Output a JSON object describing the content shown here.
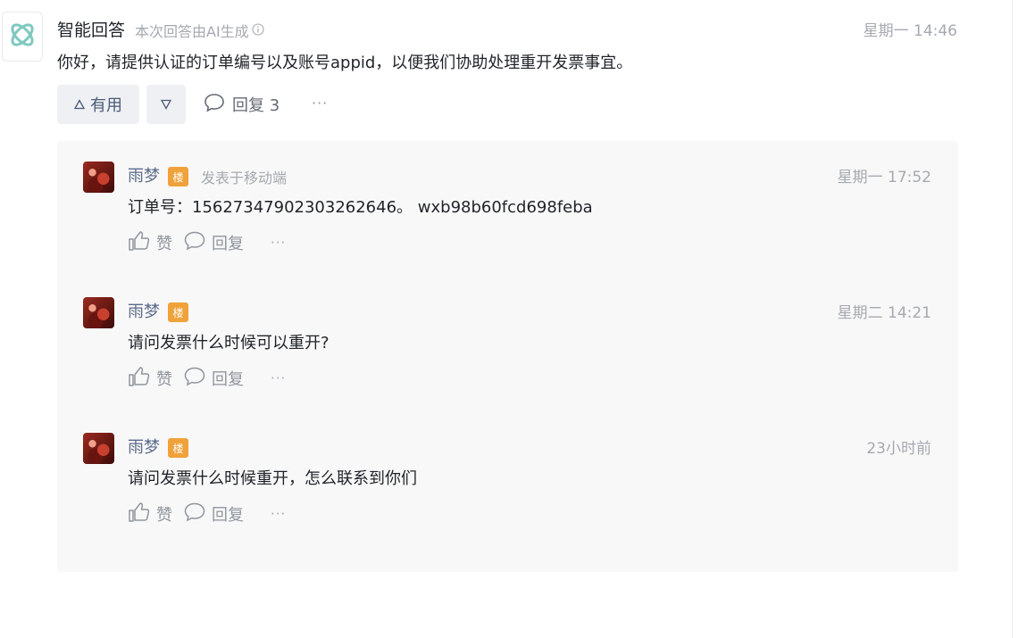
{
  "answer": {
    "author": "智能回答",
    "note": "本次回答由AI生成",
    "time": "星期一 14:46",
    "body": "你好，请提供认证的订单编号以及账号appid，以便我们协助处理重开发票事宜。",
    "useful_label": "有用",
    "reply_label": "回复 3",
    "more": "···",
    "icons": {
      "avatar": "ai-logo-icon",
      "info": "info-circle-icon",
      "useful": "triangle-up-icon",
      "not_useful": "triangle-down-icon",
      "reply": "comment-bubble-icon"
    }
  },
  "replies": [
    {
      "name": "雨梦",
      "badge": "楼",
      "posted_from": "发表于移动端",
      "time": "星期一 17:52",
      "text": "订单号：1562734790230326264​6。 wxb98b60fcd698feba",
      "like_label": "赞",
      "reply_label": "回复",
      "more": "···"
    },
    {
      "name": "雨梦",
      "badge": "楼",
      "posted_from": "",
      "time": "星期二 14:21",
      "text": "请问发票什么时候可以重开?",
      "like_label": "赞",
      "reply_label": "回复",
      "more": "···"
    },
    {
      "name": "雨梦",
      "badge": "楼",
      "posted_from": "",
      "time": "23小时前",
      "text": "请问发票什么时候重开，怎么联系到你们",
      "like_label": "赞",
      "reply_label": "回复",
      "more": "···"
    }
  ],
  "colors": {
    "badge": "#f0a23a",
    "reply_name": "#5a6a8a",
    "panel_bg": "#f8f8f8",
    "ai_logo": "#7fc8c0"
  }
}
